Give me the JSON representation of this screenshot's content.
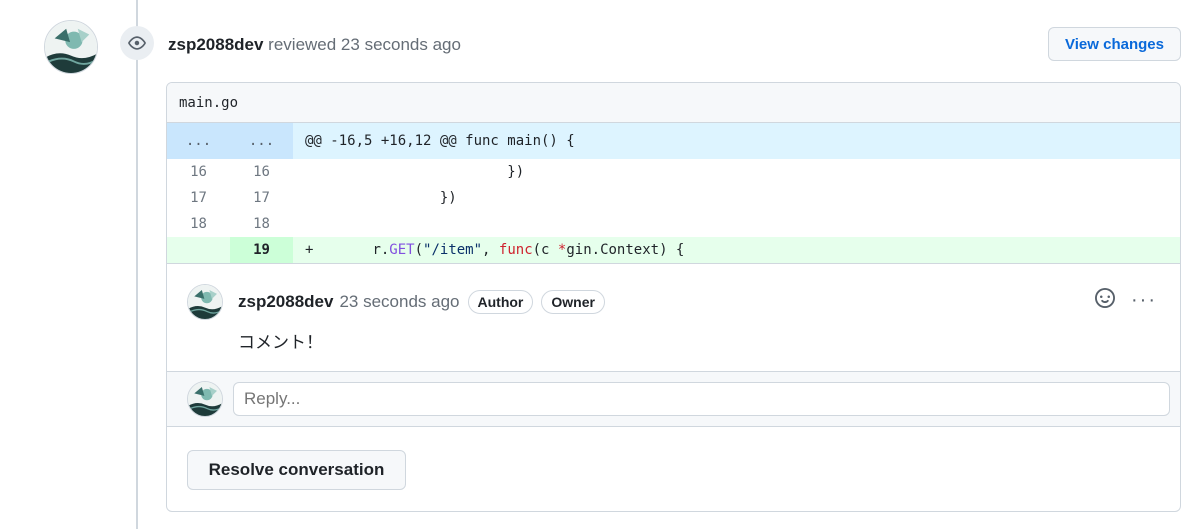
{
  "review": {
    "author": "zsp2088dev",
    "action_text": " reviewed 23 seconds ago",
    "view_changes_label": "View changes"
  },
  "file": {
    "name": "main.go"
  },
  "diff": {
    "hunk_left": "...",
    "hunk_right": "...",
    "hunk_header": "@@ -16,5 +16,12 @@ func main() {",
    "lines": [
      {
        "old": "16",
        "new": "16",
        "code": "                        })"
      },
      {
        "old": "17",
        "new": "17",
        "code": "                })"
      },
      {
        "old": "18",
        "new": "18",
        "code": ""
      }
    ],
    "added": {
      "new": "19",
      "prefix": "+       ",
      "tokens": [
        "r.",
        "GET",
        "(",
        "\"/item\"",
        ", ",
        "func",
        "(c ",
        "*",
        "gin.Context) {"
      ]
    }
  },
  "comment": {
    "author": "zsp2088dev",
    "time": "23 seconds ago",
    "labels": [
      "Author",
      "Owner"
    ],
    "body": "コメント！",
    "more_label": "···"
  },
  "reply": {
    "placeholder": "Reply..."
  },
  "resolve_label": "Resolve conversation",
  "colors": {
    "accent": "#0969da",
    "hunk_bg": "#ddf4ff",
    "add_bg": "#e6ffec"
  }
}
